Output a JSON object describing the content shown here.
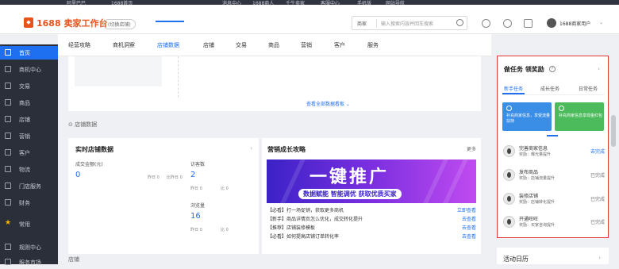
{
  "top_strip": {
    "items": [
      "阿里巴巴",
      "1688首页",
      "消息中心",
      "1688商人",
      "千牛卖家",
      "客服中心",
      "手机版",
      "网站导航"
    ]
  },
  "header": {
    "brand": "1688 卖家工作台",
    "badge": "(切换店铺)",
    "search_type": "商家",
    "search_placeholder": "输入搜索内容并回车搜索",
    "user_name": "1688商家用户"
  },
  "sidebar": {
    "items": [
      {
        "label": "首页",
        "icon": "home-icon",
        "active": true
      },
      {
        "label": "商机中心",
        "icon": "lead-icon"
      },
      {
        "label": "交易",
        "icon": "trade-icon"
      },
      {
        "label": "商品",
        "icon": "goods-icon"
      },
      {
        "label": "店铺",
        "icon": "shop-icon"
      },
      {
        "label": "营销",
        "icon": "marketing-icon"
      },
      {
        "label": "客户",
        "icon": "customer-icon"
      },
      {
        "label": "物流",
        "icon": "logistics-icon"
      },
      {
        "label": "门店服务",
        "icon": "service-icon"
      },
      {
        "label": "财务",
        "icon": "finance-icon"
      },
      {
        "label": "常用",
        "icon": "star-icon",
        "star": true
      },
      {
        "label": "规则中心",
        "icon": "rule-icon"
      },
      {
        "label": "服务市场",
        "icon": "market-icon"
      }
    ]
  },
  "tabs": [
    {
      "label": "经营攻略"
    },
    {
      "label": "商机洞察"
    },
    {
      "label": "店铺数据",
      "active": true
    },
    {
      "label": "店铺"
    },
    {
      "label": "交易"
    },
    {
      "label": "商品"
    },
    {
      "label": "营销"
    },
    {
      "label": "客户"
    },
    {
      "label": "服务"
    }
  ],
  "banner": {
    "more_link": "查看全部数据看板 ⌄"
  },
  "section_title": "⊙ 店铺数据",
  "shop_data": {
    "title": "实时店铺数据",
    "metrics": [
      {
        "label": "成交金额(元)",
        "value": "0",
        "sub1": "昨日 0",
        "sub2": "比昨日 0"
      },
      {
        "label": "访客数",
        "value": "2",
        "sub1": "昨日 0",
        "sub2": "比 0"
      },
      {
        "label": "浏览量",
        "value": "16",
        "sub1": "昨日 0",
        "sub2": "比 0"
      }
    ]
  },
  "growth": {
    "title": "营销成长攻略",
    "more": "更多",
    "promo_main": "一键推广",
    "promo_sub": "数据赋能 智能调优 获取优质买家",
    "news": [
      {
        "text": "【必看】打一场促销，获取更多商机",
        "link": "立即查看"
      },
      {
        "text": "【新手】商品详情页怎么优化，成交转化提升",
        "link": "去查看"
      },
      {
        "text": "【推荐】店铺装修模板",
        "link": "去查看"
      },
      {
        "text": "【必看】如何提高店铺订单转化率",
        "link": "去查看"
      }
    ]
  },
  "bottom_section": "店铺",
  "tasks_panel": {
    "title": "做任务 领奖励",
    "tabs": [
      "新手任务",
      "成长任务",
      "日常任务"
    ],
    "promo_cards": [
      {
        "text": "补充商家信息，享受流量扶持",
        "color": "#3a8ee6"
      },
      {
        "text": "补充商家信息享现金红包",
        "color": "#4cbb5c"
      }
    ],
    "tasks": [
      {
        "name": "完善商家信息",
        "desc": "奖励：曝光量提升",
        "status": "去完成",
        "link": true
      },
      {
        "name": "发布商品",
        "desc": "奖励：店铺流量提升",
        "status": "已完成"
      },
      {
        "name": "装修店铺",
        "desc": "奖励：店铺转化提升",
        "status": "已完成"
      },
      {
        "name": "开通旺旺",
        "desc": "奖励：买家咨询提升",
        "status": "已完成"
      }
    ]
  },
  "calendar": {
    "title": "活动日历"
  },
  "colors": {
    "accent": "#1f6ff1",
    "brand": "#e8531c",
    "sidebar": "#2b2f3a",
    "highlight_border": "#e53935"
  }
}
